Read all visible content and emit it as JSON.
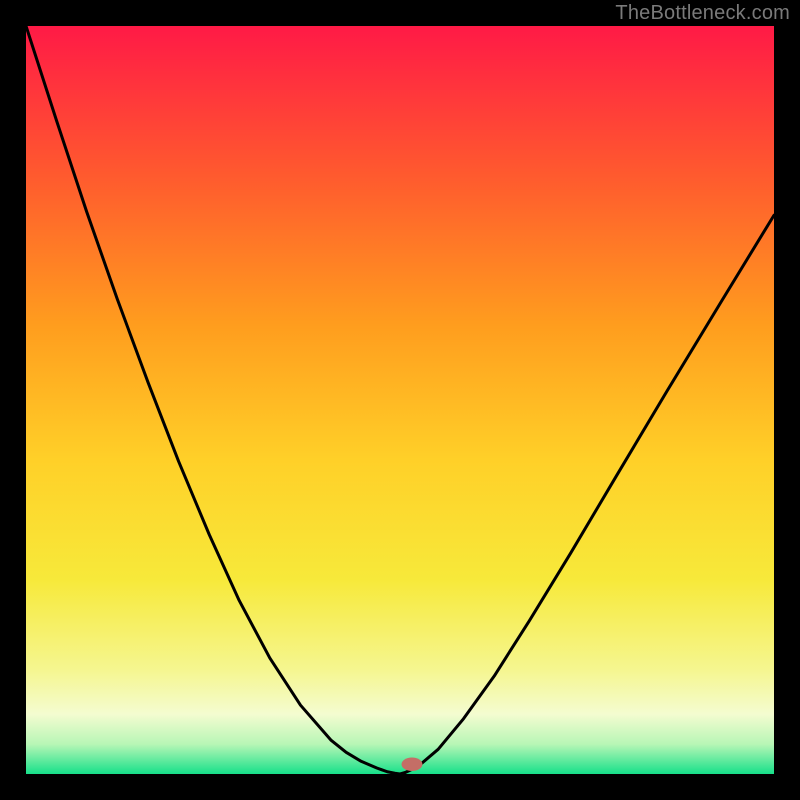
{
  "watermark": "TheBottleneck.com",
  "chart_data": {
    "type": "line",
    "title": "",
    "xlabel": "",
    "ylabel": "",
    "xlim": [
      0,
      1
    ],
    "ylim": [
      0,
      1
    ],
    "background_gradient": {
      "stops": [
        {
          "offset": 0.0,
          "color": "#ff1a46"
        },
        {
          "offset": 0.2,
          "color": "#ff5a2e"
        },
        {
          "offset": 0.4,
          "color": "#ff9d1e"
        },
        {
          "offset": 0.58,
          "color": "#ffd028"
        },
        {
          "offset": 0.74,
          "color": "#f7e93a"
        },
        {
          "offset": 0.86,
          "color": "#f5f68f"
        },
        {
          "offset": 0.92,
          "color": "#f4fcd0"
        },
        {
          "offset": 0.96,
          "color": "#b8f6b6"
        },
        {
          "offset": 1.0,
          "color": "#17e08a"
        }
      ]
    },
    "series": [
      {
        "name": "curve",
        "color": "#000000",
        "x": [
          0.0,
          0.041,
          0.081,
          0.122,
          0.163,
          0.204,
          0.245,
          0.285,
          0.326,
          0.367,
          0.408,
          0.428,
          0.448,
          0.469,
          0.483,
          0.493,
          0.5,
          0.507,
          0.524,
          0.551,
          0.585,
          0.626,
          0.673,
          0.728,
          0.789,
          0.857,
          0.931,
          1.0
        ],
        "y": [
          1.0,
          0.873,
          0.752,
          0.635,
          0.524,
          0.418,
          0.32,
          0.232,
          0.155,
          0.092,
          0.045,
          0.029,
          0.017,
          0.008,
          0.003,
          0.001,
          0.0,
          0.002,
          0.01,
          0.033,
          0.074,
          0.131,
          0.205,
          0.295,
          0.398,
          0.512,
          0.634,
          0.747
        ]
      }
    ],
    "marker": {
      "x": 0.516,
      "y": 0.013,
      "rx": 0.014,
      "ry": 0.009,
      "color": "#c46e66"
    }
  }
}
